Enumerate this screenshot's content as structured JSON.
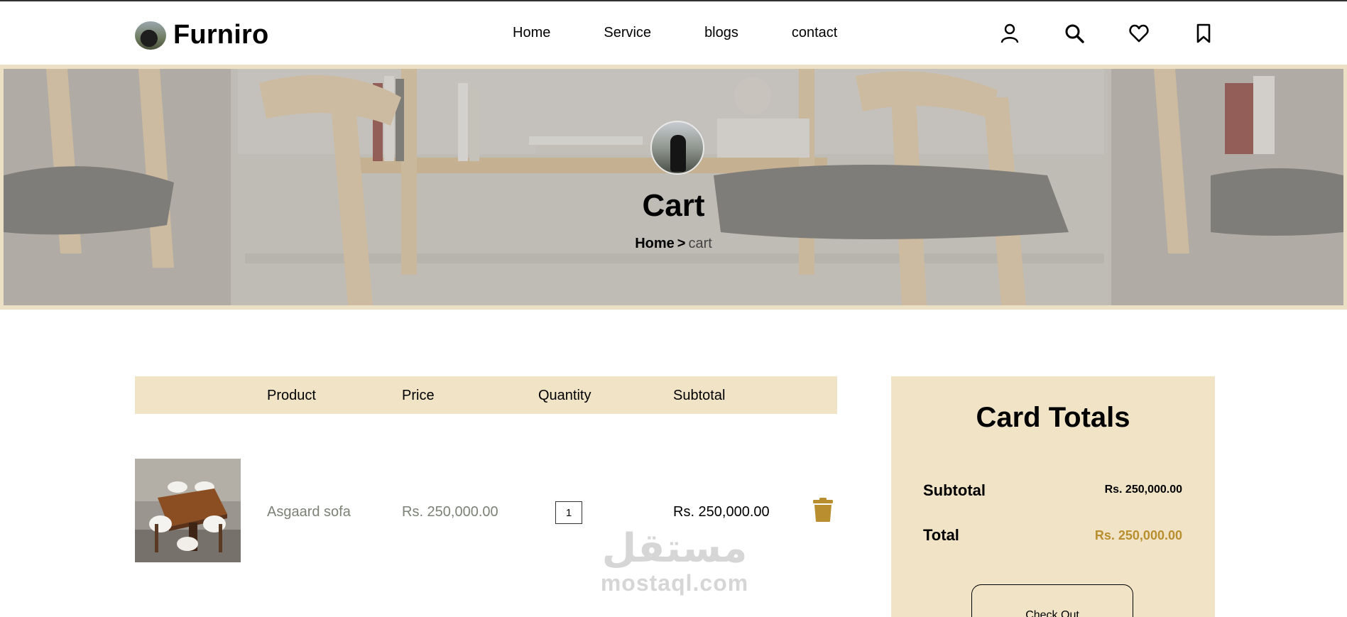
{
  "header": {
    "logo_text": "Furniro",
    "nav": [
      "Home",
      "Service",
      "blogs",
      "contact"
    ],
    "icons": [
      "user-icon",
      "search-icon",
      "heart-icon",
      "bookmark-icon"
    ]
  },
  "hero": {
    "title": "Cart",
    "breadcrumb_home": "Home",
    "breadcrumb_separator": ">",
    "breadcrumb_current": "cart"
  },
  "cart": {
    "columns": [
      "Product",
      "Price",
      "Quantity",
      "Subtotal"
    ],
    "items": [
      {
        "name": "Asgaard sofa",
        "price": "Rs. 250,000.00",
        "quantity": "1",
        "subtotal": "Rs. 250,000.00"
      }
    ]
  },
  "totals": {
    "title": "Card Totals",
    "subtotal_label": "Subtotal",
    "subtotal_value": "Rs. 250,000.00",
    "total_label": "Total",
    "total_value": "Rs. 250,000.00",
    "checkout_label": "Check Out"
  },
  "watermark": {
    "arabic": "مستقل",
    "latin": "mostaql.com"
  },
  "colors": {
    "accent": "#b88e2f",
    "panel": "#f0e3c6",
    "muted_text": "#7c8276"
  }
}
